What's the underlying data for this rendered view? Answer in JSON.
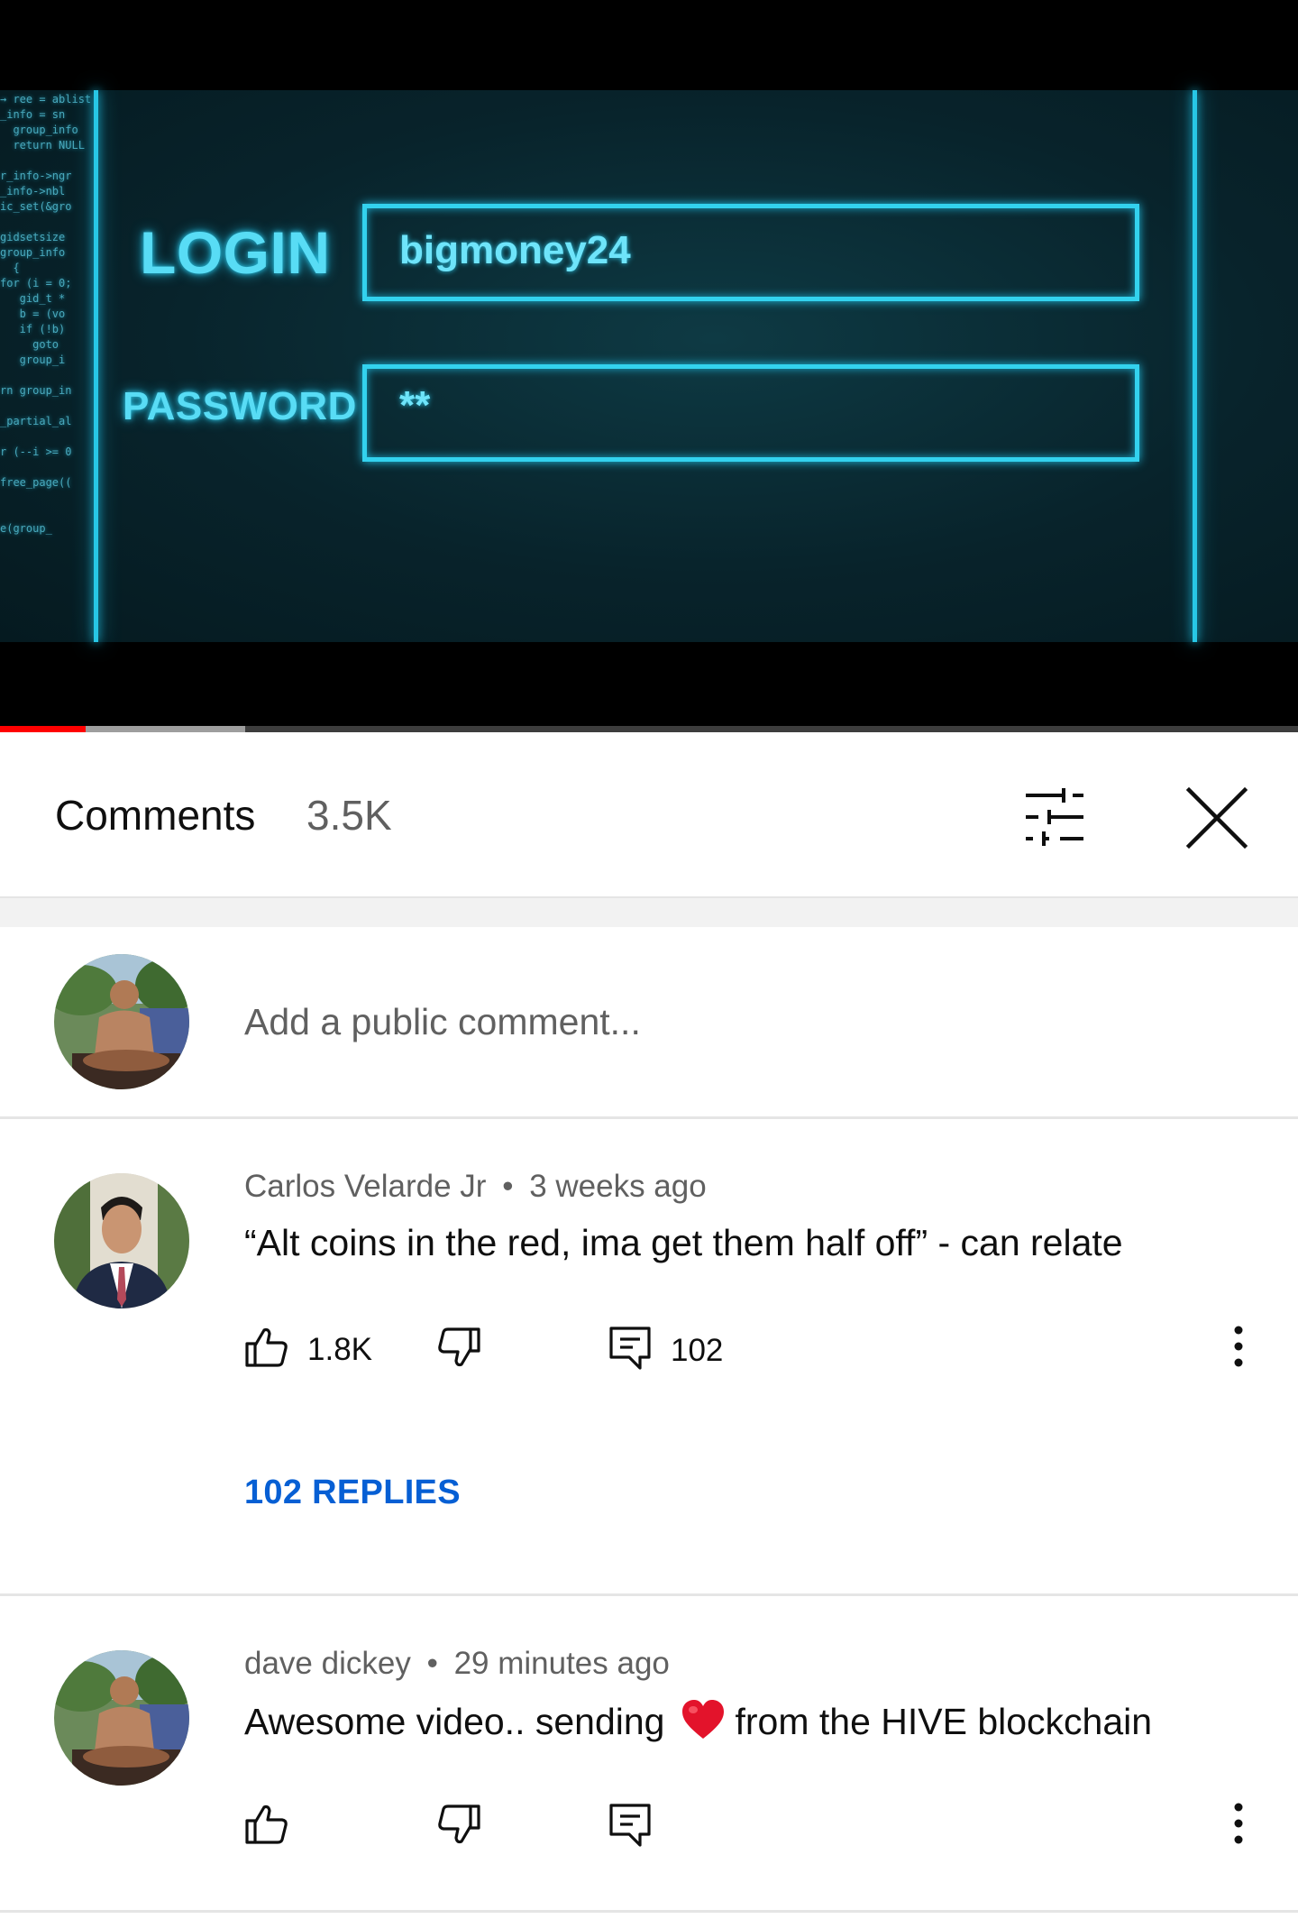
{
  "video": {
    "code_lines": [
      "→ ree = ablist",
      "_info = sn",
      "  group_info",
      "  return NULL",
      "",
      "r_info->ngr",
      "_info->nbl",
      "ic_set(&gro",
      "",
      "gidsetsize",
      "group_info",
      "  {",
      "for (i = 0;",
      "   gid_t *",
      "   b = (vo",
      "   if (!b)",
      "     goto",
      "   group_i",
      "",
      "rn group_in",
      "",
      "_partial_al",
      "",
      "r (--i >= 0",
      "",
      "free_page((",
      "",
      "",
      "e(group_"
    ],
    "login_label": "LOGIN",
    "login_value": "bigmoney24",
    "password_label": "PASSWORD",
    "password_value": "**",
    "progress": {
      "played_fraction": 0.066,
      "buffered_fraction": 0.189
    }
  },
  "header": {
    "title": "Comments",
    "count": "3.5K",
    "filter_icon": "sort-filter-icon",
    "close_icon": "close-icon"
  },
  "add_comment": {
    "placeholder": "Add a public comment..."
  },
  "comments": [
    {
      "author": "Carlos Velarde Jr",
      "time": "3 weeks ago",
      "text": "“Alt coins in the red, ima get them half off” - can relate",
      "likes": "1.8K",
      "reply_count": "102",
      "replies_label": "102 REPLIES"
    },
    {
      "author": "dave dickey",
      "time": "29 minutes ago",
      "text_before": "Awesome video.. sending",
      "text_after": "from the HIVE blockchain",
      "emoji": "red-heart"
    }
  ],
  "meta_separator": "•",
  "colors": {
    "accent_link": "#065fd4",
    "progress_played": "#ff0000",
    "neon": "#33d2ee",
    "secondary_text": "#606060"
  }
}
